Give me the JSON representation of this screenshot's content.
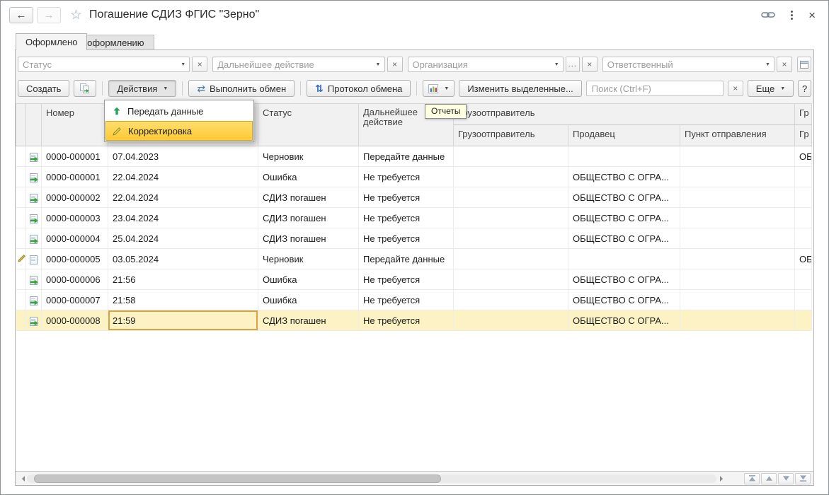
{
  "window": {
    "title": "Погашение СДИЗ ФГИС \"Зерно\""
  },
  "icons": {
    "back": "←",
    "forward": "→",
    "favorite": "☆",
    "close": "×",
    "clear": "×",
    "caret_down": "▼",
    "ellipsis": "...",
    "exchange": "⇄",
    "protocol": "⇅"
  },
  "tabs": {
    "formed": "Оформлено",
    "to_form": "К оформлению"
  },
  "filters": {
    "status_placeholder": "Статус",
    "next_action_placeholder": "Дальнейшее действие",
    "organization_placeholder": "Организация",
    "responsible_placeholder": "Ответственный"
  },
  "toolbar": {
    "create_label": "Создать",
    "actions_label": "Действия",
    "run_exchange_label": "Выполнить обмен",
    "protocol_label": "Протокол обмена",
    "edit_selected_label": "Изменить выделенные...",
    "search_placeholder": "Поиск (Ctrl+F)",
    "more_label": "Еще",
    "help_label": "?"
  },
  "actions_menu": {
    "transfer_data": "Передать данные",
    "correction": "Корректировка"
  },
  "reports_tooltip": "Отчеты",
  "table": {
    "headers": {
      "number": "Номер",
      "status": "Статус",
      "next_action": "Дальнейшее действие",
      "consignor_group": "Грузоотправитель",
      "consignor": "Грузоотправитель",
      "seller": "Продавец",
      "departure_point": "Пункт отправления",
      "next_group_truncated": "Гр",
      "next_col_truncated": "Гр"
    },
    "rows": [
      {
        "number": "0000-000001",
        "date": "07.04.2023",
        "status": "Черновик",
        "action": "Передайте данные",
        "consignor": "",
        "seller": "",
        "departure": "",
        "next": "ОБ"
      },
      {
        "number": "0000-000001",
        "date": "22.04.2024",
        "status": "Ошибка",
        "action": "Не требуется",
        "consignor": "",
        "seller": "ОБЩЕСТВО С ОГРА...",
        "departure": "",
        "next": ""
      },
      {
        "number": "0000-000002",
        "date": "22.04.2024",
        "status": "СДИЗ погашен",
        "action": "Не требуется",
        "consignor": "",
        "seller": "ОБЩЕСТВО С ОГРА...",
        "departure": "",
        "next": ""
      },
      {
        "number": "0000-000003",
        "date": "23.04.2024",
        "status": "СДИЗ погашен",
        "action": "Не требуется",
        "consignor": "",
        "seller": "ОБЩЕСТВО С ОГРА...",
        "departure": "",
        "next": ""
      },
      {
        "number": "0000-000004",
        "date": "25.04.2024",
        "status": "СДИЗ погашен",
        "action": "Не требуется",
        "consignor": "",
        "seller": "ОБЩЕСТВО С ОГРА...",
        "departure": "",
        "next": ""
      },
      {
        "number": "0000-000005",
        "date": "03.05.2024",
        "status": "Черновик",
        "action": "Передайте данные",
        "consignor": "",
        "seller": "",
        "departure": "",
        "next": "ОБ"
      },
      {
        "number": "0000-000006",
        "date": "21:56",
        "status": "Ошибка",
        "action": "Не требуется",
        "consignor": "",
        "seller": "ОБЩЕСТВО С ОГРА...",
        "departure": "",
        "next": ""
      },
      {
        "number": "0000-000007",
        "date": "21:58",
        "status": "Ошибка",
        "action": "Не требуется",
        "consignor": "",
        "seller": "ОБЩЕСТВО С ОГРА...",
        "departure": "",
        "next": ""
      },
      {
        "number": "0000-000008",
        "date": "21:59",
        "status": "СДИЗ погашен",
        "action": "Не требуется",
        "consignor": "",
        "seller": "ОБЩЕСТВО С ОГРА...",
        "departure": "",
        "next": ""
      }
    ]
  },
  "colors": {
    "selection_row": "#fcf2c4",
    "menu_highlight": "#fec832",
    "edit_cell_border": "#d9a43b",
    "accent_green": "#3aa23a",
    "accent_blue": "#2f6fbd",
    "tooltip_bg": "#ffffe1"
  }
}
